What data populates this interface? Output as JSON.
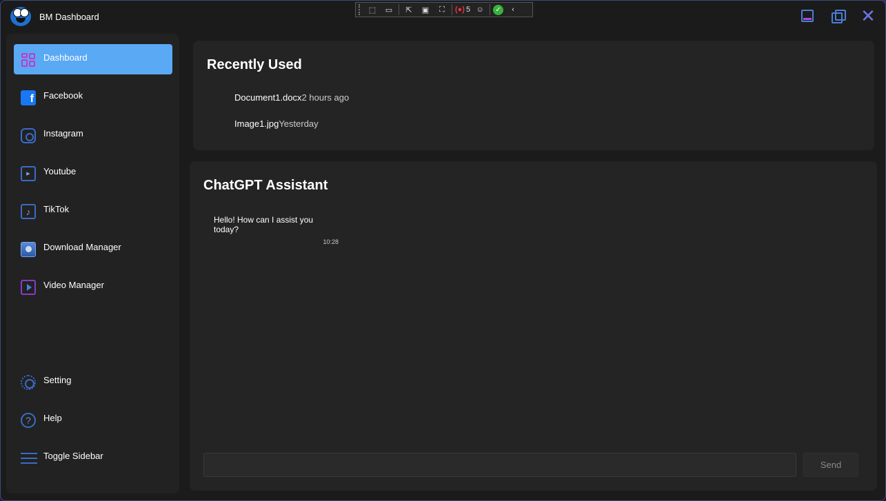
{
  "app": {
    "title": "BM Dashboard",
    "logo_icon": "cookie-monster-logo"
  },
  "debug_toolbar": {
    "items": [
      "select-element-icon",
      "video-camera-icon",
      "pointer-select-icon",
      "frame-icon",
      "track-focus-icon",
      "hot-reload-icon",
      "accessibility-icon",
      "check-icon",
      "collapse-chevron-icon"
    ],
    "count": "5"
  },
  "window_controls": {
    "minimize": "minimize-icon",
    "maximize": "maximize-icon",
    "close": "close-icon"
  },
  "sidebar": {
    "items": [
      {
        "label": "Dashboard",
        "icon": "dashboard-icon",
        "active": true
      },
      {
        "label": "Facebook",
        "icon": "facebook-icon"
      },
      {
        "label": "Instagram",
        "icon": "instagram-icon"
      },
      {
        "label": "Youtube",
        "icon": "youtube-icon"
      },
      {
        "label": "TikTok",
        "icon": "tiktok-icon"
      },
      {
        "label": "Download Manager",
        "icon": "download-manager-icon"
      },
      {
        "label": "Video Manager",
        "icon": "video-manager-icon"
      }
    ],
    "bottom_items": [
      {
        "label": "Setting",
        "icon": "gear-icon"
      },
      {
        "label": "Help",
        "icon": "help-icon"
      },
      {
        "label": "Toggle Sidebar",
        "icon": "hamburger-icon"
      }
    ]
  },
  "recently_used": {
    "title": "Recently Used",
    "items": [
      {
        "name": "Document1.docx",
        "time": "2 hours ago"
      },
      {
        "name": "Image1.jpg",
        "time": "Yesterday"
      }
    ]
  },
  "chat": {
    "title": "ChatGPT Assistant",
    "messages": [
      {
        "text": "Hello! How can I assist you today?",
        "time": "10:28"
      }
    ],
    "input_value": "",
    "send_label": "Send"
  },
  "colors": {
    "accent": "#5aa9f5",
    "window_bg": "#1b1b1b",
    "panel_bg": "#242424",
    "icon_blue": "#3a6cc8",
    "icon_purple": "#b04ae0"
  }
}
